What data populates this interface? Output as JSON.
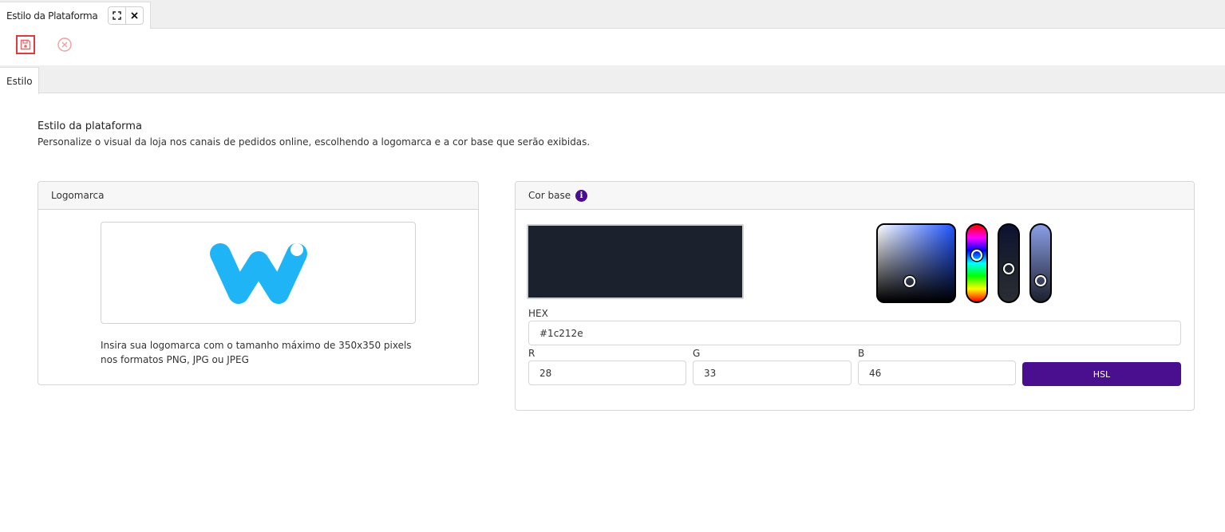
{
  "tabbar": {
    "doc_tab_label": "Estilo da Plataforma"
  },
  "section_tabs": {
    "active": "Estilo"
  },
  "page": {
    "title": "Estilo da plataforma",
    "description": "Personalize o visual da loja nos canais de pedidos online, escolhendo a logomarca e a cor base que serão exibidas."
  },
  "logo_panel": {
    "title": "Logomarca",
    "hint": "Insira sua logomarca com o tamanho máximo de 350x350 pixels nos formatos PNG, JPG ou JPEG",
    "logo_color": "#1eb4f5"
  },
  "color_panel": {
    "title": "Cor base",
    "info_glyph": "i",
    "swatch_color": "#1c212e",
    "hex_label": "HEX",
    "hex_value": "#1c212e",
    "r_label": "R",
    "r_value": "28",
    "g_label": "G",
    "g_value": "33",
    "b_label": "B",
    "b_value": "46",
    "mode_button": "HSL",
    "accent_color": "#4a0f8f"
  }
}
